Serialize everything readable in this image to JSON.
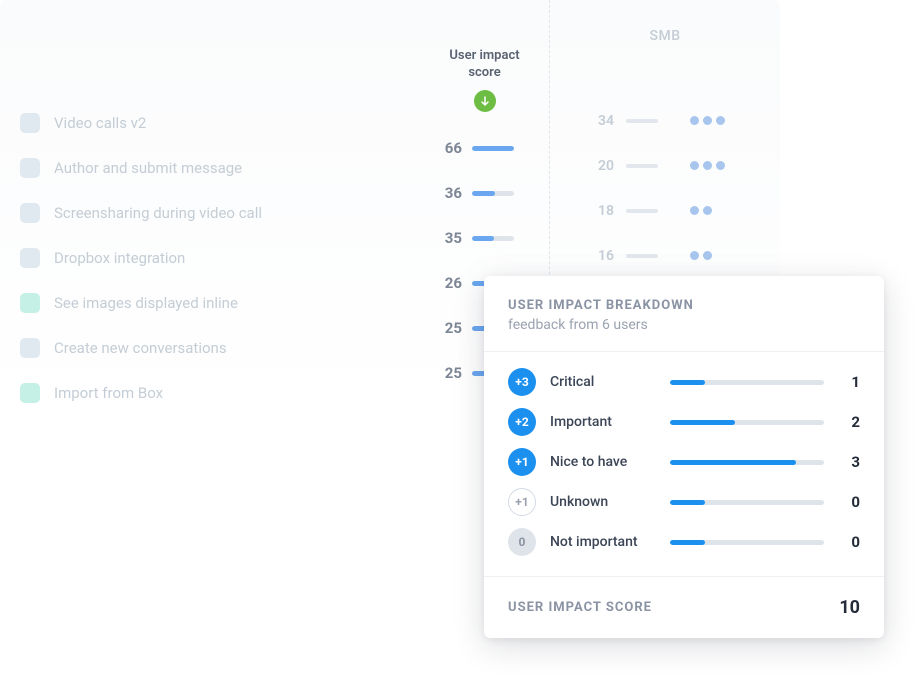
{
  "features": [
    {
      "label": "Video calls v2",
      "checked_color": "default"
    },
    {
      "label": "Author and submit message",
      "checked_color": "default"
    },
    {
      "label": "Screensharing during video call",
      "checked_color": "default"
    },
    {
      "label": "Dropbox integration",
      "checked_color": "default"
    },
    {
      "label": "See images displayed inline",
      "checked_color": "green"
    },
    {
      "label": "Create new conversations",
      "checked_color": "default"
    },
    {
      "label": "Import from Box",
      "checked_color": "green"
    }
  ],
  "score_column": {
    "header_line1": "User impact",
    "header_line2": "score",
    "scores": [
      66,
      36,
      35,
      26,
      25,
      25
    ]
  },
  "smb_column": {
    "header": "SMB",
    "rows": [
      {
        "value": 34,
        "dots": 3
      },
      {
        "value": 20,
        "dots": 3
      },
      {
        "value": 18,
        "dots": 2
      },
      {
        "value": 16,
        "dots": 2
      }
    ]
  },
  "breakdown": {
    "title": "USER IMPACT BREAKDOWN",
    "subtitle": "feedback from 6 users",
    "rows": [
      {
        "badge": "+3",
        "badge_style": "filled",
        "label": "Critical",
        "count": 1,
        "bar_pct": 23
      },
      {
        "badge": "+2",
        "badge_style": "filled",
        "label": "Important",
        "count": 2,
        "bar_pct": 42
      },
      {
        "badge": "+1",
        "badge_style": "filled",
        "label": "Nice to have",
        "count": 3,
        "bar_pct": 82
      },
      {
        "badge": "+1",
        "badge_style": "outline",
        "label": "Unknown",
        "count": 0,
        "bar_pct": 23
      },
      {
        "badge": "0",
        "badge_style": "gray",
        "label": "Not important",
        "count": 0,
        "bar_pct": 23
      }
    ],
    "footer_label": "USER IMPACT SCORE",
    "footer_total": 10
  }
}
